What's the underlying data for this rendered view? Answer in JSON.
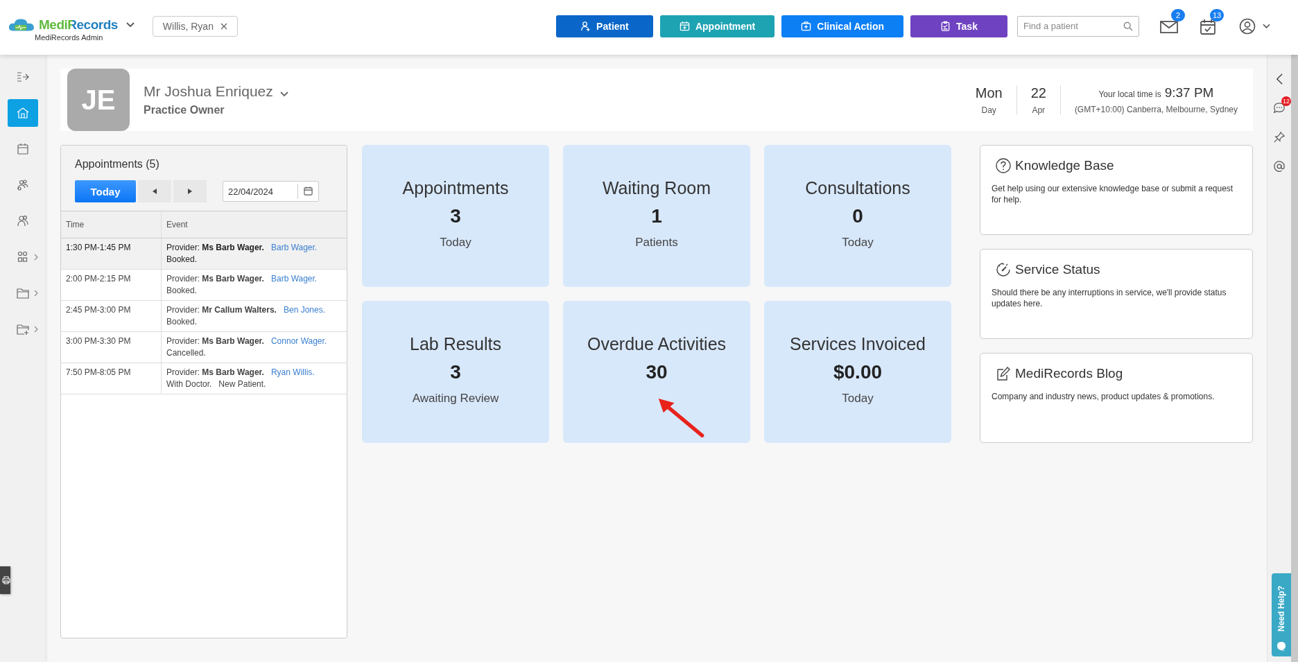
{
  "brand": {
    "name": "MediRecords",
    "subtitle": "MediRecords Admin"
  },
  "open_patient": {
    "label": "Willis, Ryan"
  },
  "actions": [
    {
      "label": "Patient",
      "kind": "patient",
      "color": "#0a66c8"
    },
    {
      "label": "Appointment",
      "kind": "appointment",
      "color": "#1ea3b3"
    },
    {
      "label": "Clinical Action",
      "kind": "clinical",
      "color": "#0d7ff5"
    },
    {
      "label": "Task",
      "kind": "task",
      "color": "#6f42c1"
    }
  ],
  "search": {
    "placeholder": "Find a patient"
  },
  "notifications": [
    {
      "kind": "mail",
      "badge": "2"
    },
    {
      "kind": "tasks",
      "badge": "13"
    }
  ],
  "sidebar": {
    "items": [
      {
        "kind": "expand",
        "selected": false,
        "submenu": false
      },
      {
        "kind": "home",
        "selected": true,
        "submenu": false
      },
      {
        "kind": "calendar",
        "selected": false,
        "submenu": false
      },
      {
        "kind": "group",
        "selected": false,
        "submenu": false
      },
      {
        "kind": "people",
        "selected": false,
        "submenu": false
      },
      {
        "kind": "apps",
        "selected": false,
        "submenu": true
      },
      {
        "kind": "folder",
        "selected": false,
        "submenu": true
      },
      {
        "kind": "folder-plus",
        "selected": false,
        "submenu": true
      }
    ]
  },
  "profile": {
    "initials": "JE",
    "name": "Mr Joshua Enriquez",
    "role": "Practice Owner"
  },
  "clock": {
    "day": "Mon",
    "day_label": "Day",
    "date": "22",
    "month": "Apr",
    "local_time_label": "Your local time is",
    "local_time": "9:37 PM",
    "timezone": "(GMT+10:00) Canberra, Melbourne, Sydney"
  },
  "appointments": {
    "title": "Appointments (5)",
    "today_button": "Today",
    "date": "22/04/2024",
    "columns": [
      "Time",
      "Event"
    ],
    "rows": [
      {
        "time": "1:30 PM-1:45 PM",
        "provider": "Provider: **Ms Barb Wager.**",
        "patient": "Barb Wager.",
        "status": "Booked.",
        "selected": true
      },
      {
        "time": "2:00 PM-2:15 PM",
        "provider": "Provider: **Ms Barb Wager.**",
        "patient": "Barb Wager.",
        "status": "Booked.",
        "selected": false
      },
      {
        "time": "2:45 PM-3:00 PM",
        "provider": "Provider: **Mr Callum Walters.**",
        "patient": "Ben Jones.",
        "status": "Booked.",
        "selected": false
      },
      {
        "time": "3:00 PM-3:30 PM",
        "provider": "Provider: **Ms Barb Wager.**",
        "patient": "Connor Wager.",
        "status": "Cancelled.",
        "selected": false
      },
      {
        "time": "7:50 PM-8:05 PM",
        "provider": "Provider: **Ms Barb Wager.**",
        "patient": "Ryan Willis.",
        "status": "With Doctor.",
        "note": "New Patient.",
        "selected": false
      }
    ]
  },
  "tiles": [
    {
      "title": "Appointments",
      "value": "3",
      "caption": "Today"
    },
    {
      "title": "Waiting Room",
      "value": "1",
      "caption": "Patients"
    },
    {
      "title": "Consultations",
      "value": "0",
      "caption": "Today"
    },
    {
      "title": "Lab Results",
      "value": "3",
      "caption": "Awaiting Review"
    },
    {
      "title": "Overdue Activities",
      "value": "30"
    },
    {
      "title": "Services Invoiced",
      "value": "$0.00",
      "caption": "Today"
    }
  ],
  "info_cards": [
    {
      "kind": "help",
      "title": "Knowledge Base",
      "text": "Get help using our extensive knowledge base or submit a request for help."
    },
    {
      "kind": "status",
      "title": "Service Status",
      "text": "Should there be any interruptions in service, we'll provide status updates here."
    },
    {
      "kind": "blog",
      "title": "MediRecords Blog",
      "text": "Company and industry news, product updates & promotions."
    }
  ],
  "right_rail": {
    "chat_badge": "12"
  },
  "help_tab": {
    "label": "Need Help?"
  }
}
